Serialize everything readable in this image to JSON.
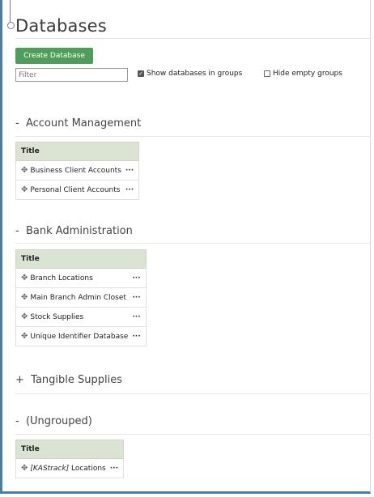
{
  "header": {
    "title": "Databases"
  },
  "toolbar": {
    "create_label": "Create Database",
    "filter_placeholder": "Filter",
    "show_groups_label": "Show databases in groups",
    "show_groups_checked": true,
    "hide_empty_label": "Hide empty groups",
    "hide_empty_checked": false
  },
  "groups": [
    {
      "toggle": "-",
      "name": "Account Management",
      "column": "Title",
      "rows": [
        "Business Client Accounts",
        "Personal Client Accounts"
      ]
    },
    {
      "toggle": "-",
      "name": "Bank Administration",
      "column": "Title",
      "rows": [
        "Branch Locations",
        "Main Branch Admin Closet",
        "Stock Supplies",
        "Unique Identifier Database"
      ]
    },
    {
      "toggle": "+",
      "name": "Tangible Supplies"
    },
    {
      "toggle": "-",
      "name": "(Ungrouped)",
      "column": "Title",
      "rows": [
        {
          "prefix": "[KAStrack]",
          "text": "Locations"
        }
      ]
    }
  ],
  "icons": {
    "move": "move-handle-icon",
    "more": "more-options-icon"
  },
  "colors": {
    "accent": "#4a7ea6",
    "button": "#4e9e5a",
    "table_header": "#dbe3d3"
  }
}
